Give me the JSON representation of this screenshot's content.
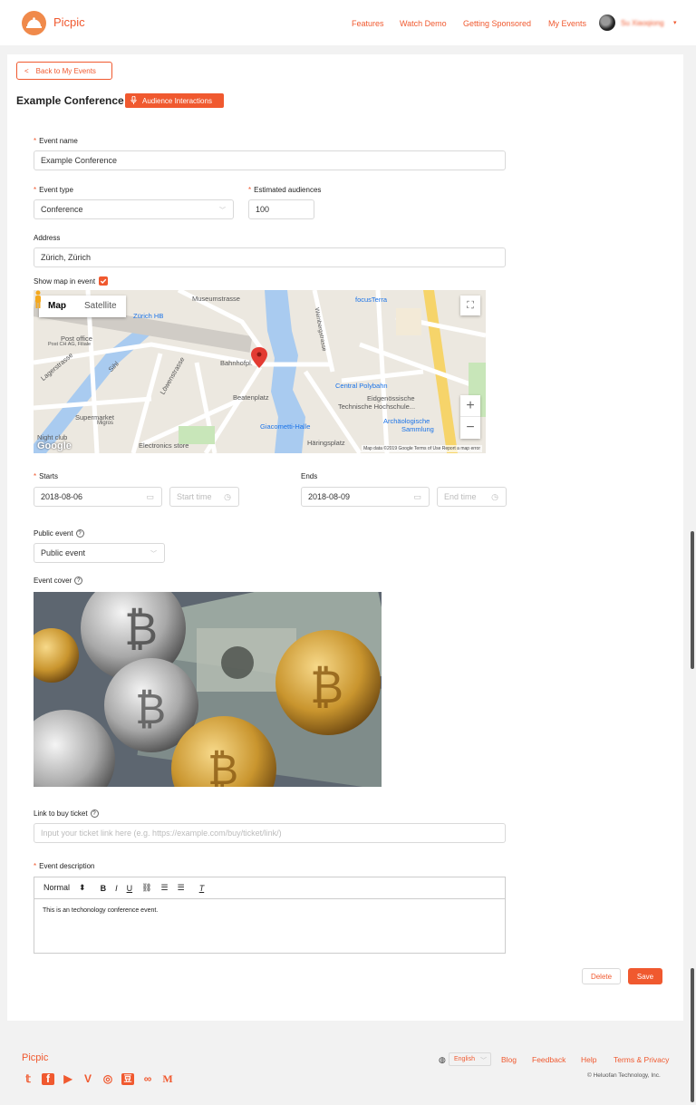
{
  "header": {
    "brand": "Picpic",
    "nav": [
      "Features",
      "Watch Demo",
      "Getting Sponsored",
      "My Events"
    ],
    "username": "Su Xiaoqiong",
    "caret": "▾"
  },
  "page": {
    "back_label": "Back to My Events",
    "title": "Example Conference",
    "audience_label": "Audience Interactions"
  },
  "form": {
    "required_mark": "*",
    "event_name_label": "Event name",
    "event_name_value": "Example Conference",
    "event_type_label": "Event type",
    "event_type_value": "Conference",
    "audiences_label": "Estimated audiences",
    "audiences_value": "100",
    "address_label": "Address",
    "address_value": "Zürich, Zürich",
    "show_map_label": "Show map in event",
    "show_map_checked": true,
    "starts_label": "Starts",
    "start_date": "2018-08-06",
    "start_time_placeholder": "Start time",
    "ends_label": "Ends",
    "end_date": "2018-08-09",
    "end_time_placeholder": "End time",
    "public_label": "Public event",
    "public_value": "Public event",
    "cover_label": "Event cover",
    "ticket_label": "Link to buy ticket",
    "ticket_placeholder": "Input your ticket link here (e.g. https://example.com/buy/ticket/link/)",
    "description_label": "Event description",
    "editor_format": "Normal",
    "editor_text": "This is an techonology conference event.",
    "delete_label": "Delete",
    "save_label": "Save"
  },
  "map": {
    "type_map": "Map",
    "type_satellite": "Satellite",
    "labels": {
      "museumstrasse": "Museumstrasse",
      "focus_terra": "focusTerra",
      "zurich_hb": "Zürich HB",
      "post_office": "Post office",
      "post_office_sub": "Post CH AG, Filiale",
      "lagerstrasse": "Lagerstrasse",
      "sihl": "Sihl",
      "loewenstrasse": "Löwenstrasse",
      "bahnhofpl": "Bahnhofpl.",
      "central_polybahn": "Central Polybahn",
      "beatenplatz": "Beatenplatz",
      "eth": "Eidgenössische",
      "eth2": "Technische Hochschule...",
      "supermarket": "Supermarket",
      "migros": "Migros",
      "giacometti": "Giacometti-Halle",
      "archaeo": "Archäologische",
      "archaeo2": "Sammlung",
      "nightclub": "Night club",
      "electronics": "Electronics store",
      "haeringsplatz": "Häringsplatz",
      "weinbergstrasse": "Weinbergstrasse",
      "google": "Google",
      "attrib": "Map data ©2019 Google   Terms of Use   Report a map error"
    }
  },
  "footer": {
    "brand": "Picpic",
    "language": "English",
    "links": [
      "Blog",
      "Feedback",
      "Help",
      "Terms & Privacy"
    ],
    "copyright": "© Heluofan Technology, Inc.",
    "social_icons": [
      "twitter-icon",
      "facebook-icon",
      "youtube-icon",
      "vimeo-icon",
      "instagram-icon",
      "douban-icon",
      "weibo-icon",
      "medium-icon"
    ]
  },
  "colors": {
    "accent": "#f0592f",
    "logo": "#f08a4b"
  }
}
